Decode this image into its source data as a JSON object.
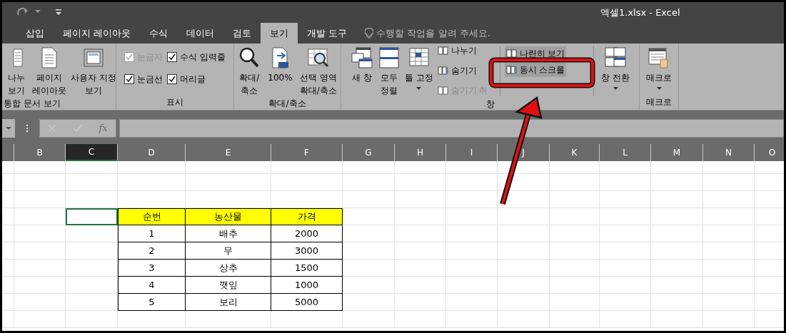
{
  "window": {
    "title": "엑셀1.xlsx - Excel"
  },
  "tabs": [
    {
      "label": "삽입",
      "selected": false
    },
    {
      "label": "페이지 레이아웃",
      "selected": false
    },
    {
      "label": "수식",
      "selected": false
    },
    {
      "label": "데이터",
      "selected": false
    },
    {
      "label": "검토",
      "selected": false
    },
    {
      "label": "보기",
      "selected": true
    },
    {
      "label": "개발 도구",
      "selected": false
    }
  ],
  "tell_me": {
    "placeholder": "수행할 작업을 알려 주세요."
  },
  "ribbon": {
    "groups": [
      {
        "label": "통합 문서 보기",
        "items": [
          {
            "kind": "large",
            "lines": [
              "나누",
              "보기"
            ]
          },
          {
            "kind": "large",
            "lines": [
              "페이지",
              "레이아웃"
            ]
          },
          {
            "kind": "large",
            "lines": [
              "사용자 지정",
              "보기"
            ]
          }
        ]
      },
      {
        "label": "표시",
        "items": [
          {
            "kind": "stack",
            "items": [
              {
                "kind": "check",
                "label": "눈금자",
                "checked": true,
                "disabled": true
              },
              {
                "kind": "check",
                "label": "눈금선",
                "checked": true,
                "disabled": false
              }
            ]
          },
          {
            "kind": "stack",
            "items": [
              {
                "kind": "check",
                "label": "수식 입력줄",
                "checked": true,
                "disabled": false
              },
              {
                "kind": "check",
                "label": "머리글",
                "checked": true,
                "disabled": false
              }
            ]
          }
        ]
      },
      {
        "label": "확대/축소",
        "items": [
          {
            "kind": "large",
            "lines": [
              "확대/",
              "축소"
            ]
          },
          {
            "kind": "large",
            "lines": [
              "100%"
            ]
          },
          {
            "kind": "large",
            "lines": [
              "선택 영역",
              "확대/축소"
            ]
          }
        ]
      },
      {
        "label": "창",
        "items": [
          {
            "kind": "large",
            "lines": [
              "새 창"
            ]
          },
          {
            "kind": "large",
            "lines": [
              "모두",
              "정렬"
            ]
          },
          {
            "kind": "large",
            "lines": [
              "틀 고정"
            ],
            "dropdown": true
          },
          {
            "kind": "stack",
            "items": [
              {
                "kind": "small",
                "label": "나누기",
                "disabled": false,
                "highlighted": false
              },
              {
                "kind": "small",
                "label": "숨기기",
                "disabled": false,
                "highlighted": false
              },
              {
                "kind": "small",
                "label": "숨기기 취",
                "disabled": true,
                "highlighted": false
              }
            ]
          },
          {
            "kind": "stack",
            "items": [
              {
                "kind": "small",
                "label": "나란히 보기",
                "disabled": false,
                "highlighted": true
              },
              {
                "kind": "small",
                "label": "동시 스크롤",
                "disabled": false,
                "highlighted": true
              }
            ]
          },
          {
            "kind": "large",
            "lines": [
              "창 전환"
            ],
            "dropdown": true
          }
        ]
      },
      {
        "label": "매크로",
        "items": [
          {
            "kind": "large",
            "lines": [
              "매크로"
            ],
            "dropdown": true
          }
        ]
      }
    ]
  },
  "formula_bar": {
    "function_label": "fx"
  },
  "sheet": {
    "columns": [
      {
        "label": "B",
        "selected": false
      },
      {
        "label": "C",
        "selected": true
      },
      {
        "label": "D",
        "selected": false
      },
      {
        "label": "E",
        "selected": false
      },
      {
        "label": "F",
        "selected": false
      },
      {
        "label": "G",
        "selected": false
      },
      {
        "label": "H",
        "selected": false
      },
      {
        "label": "I",
        "selected": false
      },
      {
        "label": "J",
        "selected": false
      },
      {
        "label": "K",
        "selected": false
      },
      {
        "label": "L",
        "selected": false
      },
      {
        "label": "M",
        "selected": false
      },
      {
        "label": "N",
        "selected": false
      },
      {
        "label": "O",
        "selected": false
      }
    ],
    "table": {
      "header": [
        "순번",
        "농산물",
        "가격"
      ],
      "rows": [
        [
          "1",
          "배추",
          "2000"
        ],
        [
          "2",
          "무",
          "3000"
        ],
        [
          "3",
          "상추",
          "1500"
        ],
        [
          "4",
          "깻잎",
          "1000"
        ],
        [
          "5",
          "보리",
          "5000"
        ]
      ]
    }
  }
}
